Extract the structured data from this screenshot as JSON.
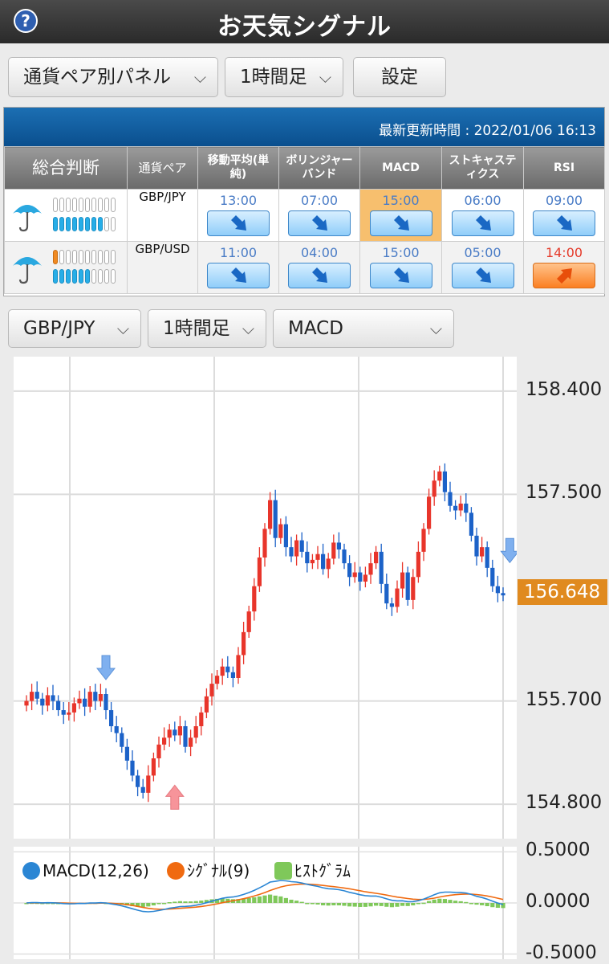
{
  "header": {
    "title": "お天気シグナル",
    "help_icon": "question-circle-icon"
  },
  "controls": {
    "view": "通貨ペア別パネル",
    "timeframe": "1時間足",
    "settings": "設定"
  },
  "panel": {
    "updated": "最新更新時間 : 2022/01/06 16:13",
    "headers": [
      "総合判断",
      "通貨ペア",
      "移動平均(単純)",
      "ボリンジャーバンド",
      "MACD",
      "ストキャスティクス",
      "RSI"
    ],
    "rows": [
      {
        "pair": "GBP/JPY",
        "weather_icon": "umbrella-icon",
        "meter": {
          "top": 0,
          "bottom": 8,
          "total": 10
        },
        "signals": [
          {
            "time": "13:00",
            "dir": "down"
          },
          {
            "time": "07:00",
            "dir": "down"
          },
          {
            "time": "15:00",
            "dir": "down",
            "highlight": true
          },
          {
            "time": "06:00",
            "dir": "down"
          },
          {
            "time": "09:00",
            "dir": "down"
          }
        ]
      },
      {
        "pair": "GBP/USD",
        "weather_icon": "umbrella-icon",
        "meter": {
          "top": 1,
          "bottom": 6,
          "total": 10
        },
        "signals": [
          {
            "time": "11:00",
            "dir": "down"
          },
          {
            "time": "04:00",
            "dir": "down"
          },
          {
            "time": "15:00",
            "dir": "down"
          },
          {
            "time": "05:00",
            "dir": "down"
          },
          {
            "time": "14:00",
            "dir": "up"
          }
        ]
      }
    ],
    "colors": {
      "down_button": "#8fcdf9",
      "up_button": "#fb7f22",
      "highlight": "#f7bf6e"
    }
  },
  "chart_controls": {
    "pair": "GBP/JPY",
    "timeframe": "1時間足",
    "indicator": "MACD"
  },
  "chart_data": [
    {
      "type": "candlestick",
      "ylim": [
        154.5,
        158.7
      ],
      "y_ticks": [
        "158.400",
        "157.500",
        "155.700",
        "154.800"
      ],
      "y_tick_values": [
        158.4,
        157.5,
        155.7,
        154.8
      ],
      "current_price": "156.648",
      "current_price_value": 156.648,
      "closes": [
        155.7,
        155.78,
        155.72,
        155.66,
        155.75,
        155.7,
        155.62,
        155.58,
        155.6,
        155.68,
        155.72,
        155.65,
        155.78,
        155.7,
        155.76,
        155.62,
        155.48,
        155.42,
        155.3,
        155.18,
        155.05,
        154.95,
        154.9,
        155.05,
        155.2,
        155.32,
        155.38,
        155.45,
        155.4,
        155.48,
        155.3,
        155.38,
        155.48,
        155.6,
        155.74,
        155.85,
        155.92,
        156.0,
        155.95,
        155.9,
        156.1,
        156.3,
        156.48,
        156.7,
        156.95,
        157.2,
        157.45,
        157.12,
        157.24,
        157.04,
        156.96,
        157.1,
        157.0,
        156.9,
        156.93,
        156.98,
        156.85,
        156.94,
        157.08,
        157.02,
        156.9,
        156.78,
        156.82,
        156.74,
        156.8,
        156.9,
        157.0,
        156.72,
        156.55,
        156.52,
        156.68,
        156.82,
        156.58,
        156.78,
        157.0,
        157.2,
        157.48,
        157.62,
        157.7,
        157.52,
        157.4,
        157.36,
        157.42,
        157.34,
        157.14,
        156.96,
        157.04,
        156.86,
        156.7,
        156.64,
        156.62
      ],
      "signals": [
        {
          "index": 15,
          "dir": "down"
        },
        {
          "index": 28,
          "dir": "up"
        },
        {
          "index": 89,
          "dir": "down"
        }
      ],
      "up_color": "#e8352b",
      "down_color": "#1c62c8"
    },
    {
      "type": "line",
      "legend": [
        "MACD(12,26)",
        "ｼｸﾞﾅﾙ(9)",
        "ﾋｽﾄｸﾞﾗﾑ"
      ],
      "ylim": [
        -0.55,
        0.55
      ],
      "y_ticks": [
        "0.5000",
        "0.0000",
        "-0.5000"
      ],
      "y_tick_values": [
        0.5,
        0.0,
        -0.5
      ],
      "colors": {
        "macd": "#2b86d4",
        "signal": "#f06a10",
        "histogram": "#7fc85a"
      }
    }
  ]
}
